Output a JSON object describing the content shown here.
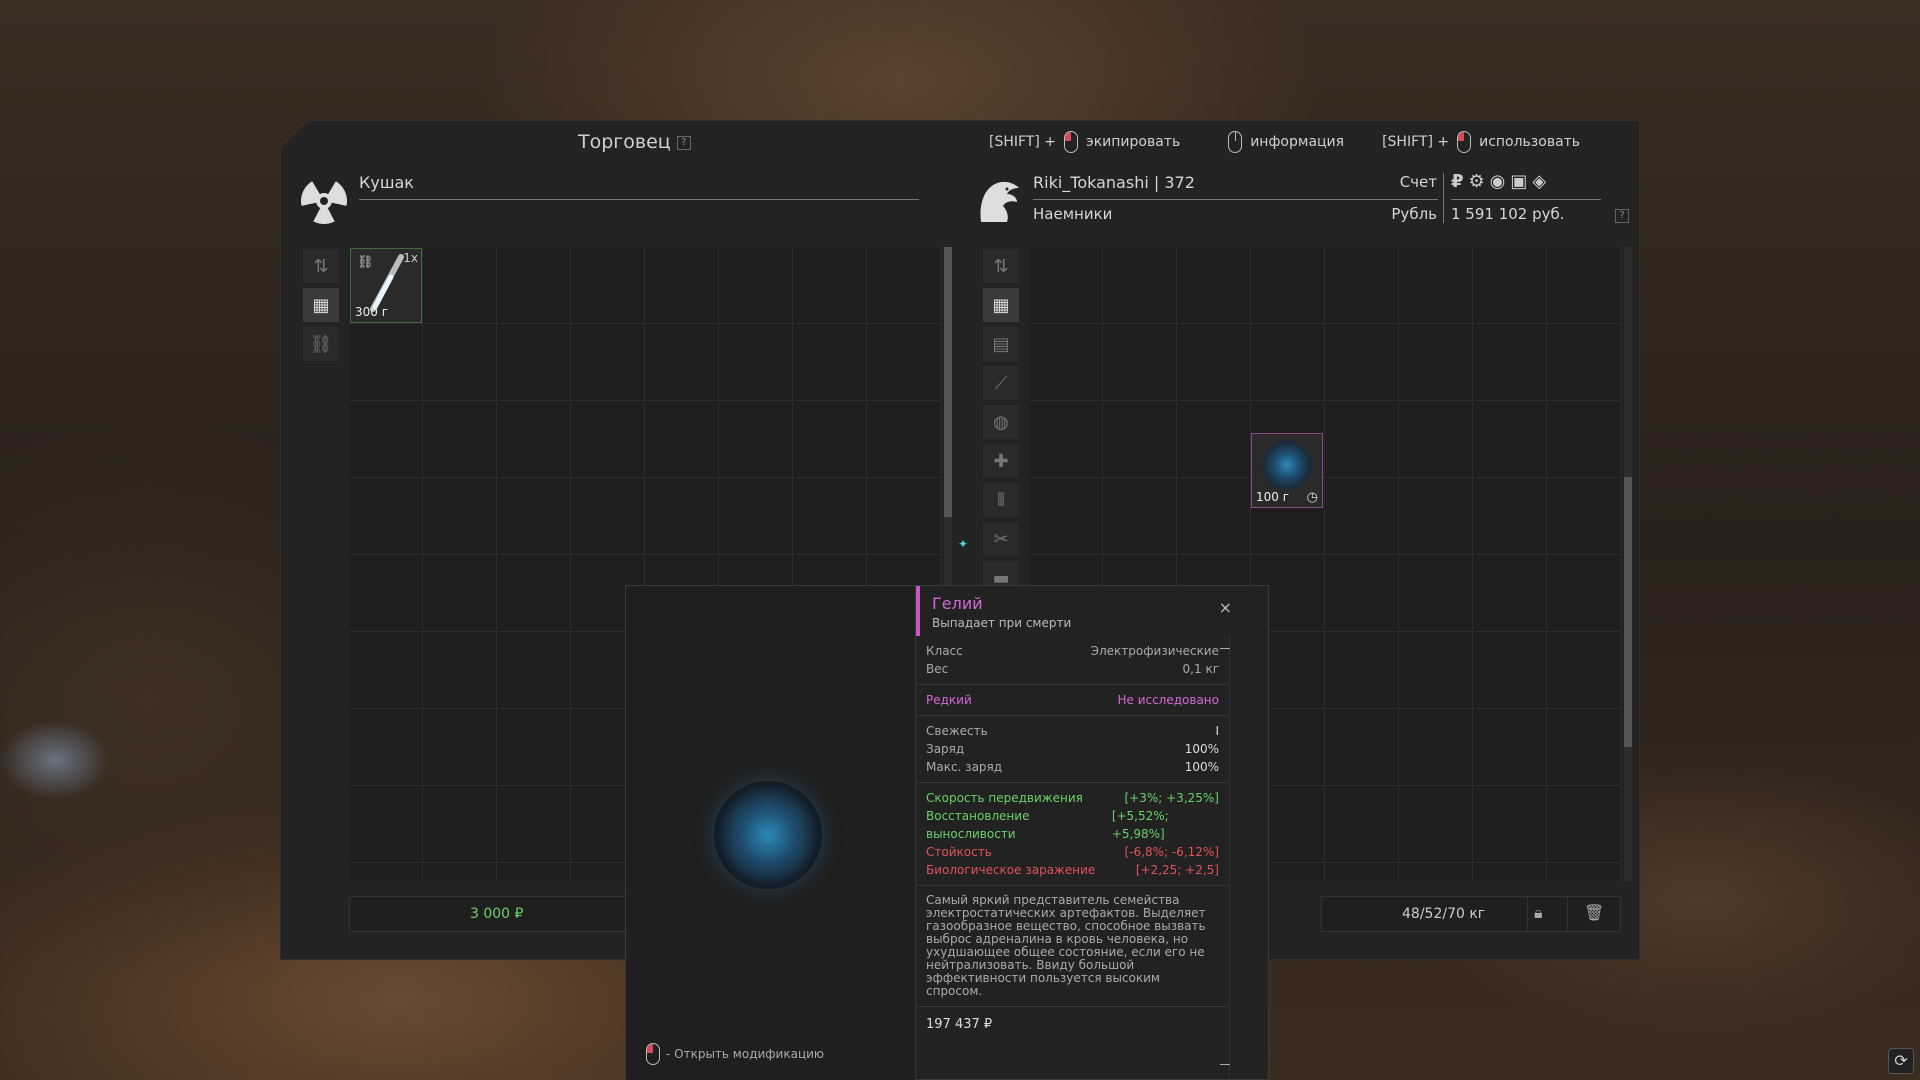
{
  "header": {
    "trader_title": "Торговец",
    "help_badge": "?",
    "hints": [
      {
        "prefix": "[SHIFT] +",
        "label": "экипировать"
      },
      {
        "prefix": "",
        "label": "информация"
      },
      {
        "prefix": "[SHIFT] +",
        "label": "использовать"
      }
    ]
  },
  "trader": {
    "name": "Кушак",
    "avatar_icon": "radiation-icon",
    "item": {
      "qty": "1x",
      "price": "300 г"
    },
    "footer_price": "3 000 ₽"
  },
  "player": {
    "name": "Riki_Tokanashi | 372",
    "faction": "Наемники",
    "account_label": "Счет",
    "currency_label": "Рубль",
    "balance": "1 591 102 руб.",
    "help_badge": "?",
    "currency_symbol": "₽",
    "item": {
      "price": "100 г"
    },
    "weight": "48/52/70 кг"
  },
  "tooltip": {
    "name": "Гелий",
    "subtitle": "Выпадает при смерти",
    "close": "×",
    "class_label": "Класс",
    "class_value": "Электрофизические",
    "weight_label": "Вес",
    "weight_value": "0,1 кг",
    "rarity": "Редкий",
    "research": "Не исследовано",
    "freshness_label": "Свежесть",
    "freshness_value": "I",
    "charge_label": "Заряд",
    "charge_value": "100%",
    "max_charge_label": "Макс. заряд",
    "max_charge_value": "100%",
    "stats": [
      {
        "label": "Скорость передвижения",
        "value": "[+3%; +3,25%]",
        "kind": "green"
      },
      {
        "label": "Восстановление выносливости",
        "value": "[+5,52%; +5,98%]",
        "kind": "green"
      },
      {
        "label": "Стойкость",
        "value": "[-6,8%; -6,12%]",
        "kind": "red"
      },
      {
        "label": "Биологическое заражение",
        "value": "[+2,25; +2,5]",
        "kind": "red"
      }
    ],
    "description": "Самый яркий представитель семейства электростатических артефактов. Выделяет газообразное вещество, способное вызвать выброс адреналина в кровь человека, но ухудшающее общее состояние, если его не нейтрализовать. Ввиду большой эффективности пользуется высоким спросом.",
    "price": "197 437 ₽",
    "open_mod": "- Открыть модификацию"
  }
}
